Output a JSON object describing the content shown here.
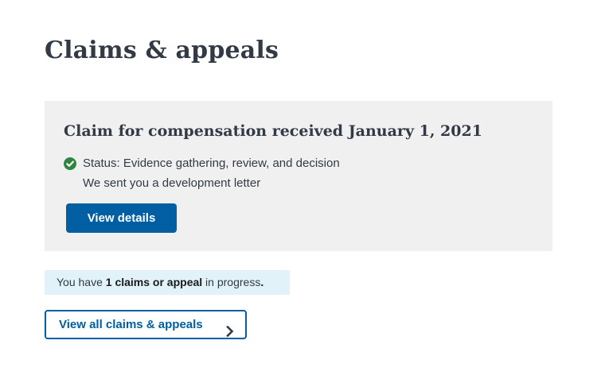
{
  "page": {
    "title": "Claims & appeals"
  },
  "claim_card": {
    "title": "Claim for compensation received January 1, 2021",
    "status": "Status: Evidence gathering, review, and decision",
    "detail": "We sent you a development letter",
    "view_details_label": "View details",
    "status_icon": "check-circle-icon"
  },
  "progress": {
    "prefix": "You have ",
    "count_text": "1 claims or appeal",
    "suffix": " in progress",
    "end": "."
  },
  "view_all": {
    "label": "View all claims & appeals",
    "icon": "chevron-right-icon"
  },
  "colors": {
    "primary": "#005ea2",
    "success": "#2e8540",
    "card_bg": "#f0f0f0",
    "alert_bg": "#e1f3f8",
    "heading": "#323a45"
  }
}
